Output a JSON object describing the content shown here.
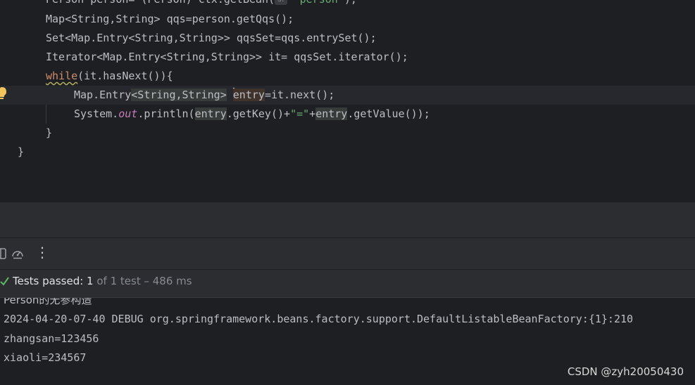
{
  "editor": {
    "line0": {
      "a": "Person person= (Person) ctx.getBean(",
      "hint": "s:",
      "str": "\"person\"",
      "b": ");"
    },
    "line1": "Map<String,String> qqs=person.getQqs();",
    "line2": "Set<Map.Entry<String,String>> qqsSet=qqs.entrySet();",
    "line3": "Iterator<Map.Entry<String,String>> it= qqsSet.iterator();",
    "line4": {
      "kw": "while",
      "rest": "(it.hasNext()){"
    },
    "line5": {
      "a": "Map.Entry",
      "b": "<String,String>",
      "c": " ",
      "var": "entry",
      "d": "=it.next();"
    },
    "line6": {
      "a": "System.",
      "out": "out",
      "b": ".println(",
      "v1": "entry",
      "c": ".getKey()+",
      "str": "\"=\"",
      "d": "+",
      "v2": "entry",
      "e": ".getValue());"
    },
    "line7": "}",
    "line8": "}"
  },
  "toolbar": {
    "icons": [
      "layout-icon",
      "gauge-icon",
      "more-vertical-icon"
    ],
    "more_glyph": "⋮"
  },
  "tests": {
    "passed_label": "Tests passed: ",
    "count": "1",
    "rest": " of 1 test – 486 ms"
  },
  "console": {
    "lines": [
      "Person的无参构造",
      "2024-04-20-07-40 DEBUG org.springframework.beans.factory.support.DefaultListableBeanFactory:{1}:210",
      "zhangsan=123456",
      "xiaoli=234567"
    ]
  },
  "watermark": "CSDN @zyh20050430",
  "colors": {
    "background": "#1e1f22",
    "panel": "#2b2d30",
    "keyword": "#cf8e6d",
    "string": "#6aab73",
    "field": "#c77dbb",
    "success": "#5fb865"
  }
}
